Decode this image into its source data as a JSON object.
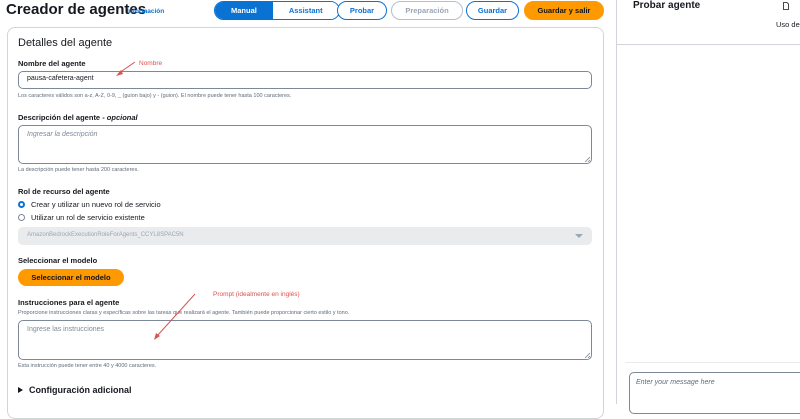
{
  "header": {
    "title": "Creador de agentes",
    "info": "Información",
    "tabs": [
      {
        "label": "Manual",
        "active": true
      },
      {
        "label": "Assistant",
        "active": false
      }
    ],
    "buttons": {
      "test": "Probar",
      "prepare": "Preparación",
      "save": "Guardar",
      "save_exit": "Guardar y salir"
    }
  },
  "details": {
    "title": "Detalles del agente",
    "name_label": "Nombre del agente",
    "name_value": "pausa-cafetera-agent",
    "name_hint": "Los caracteres válidos son a-z, A-Z, 0-9, _ (guion bajo) y - (guion). El nombre puede tener hasta 100 caracteres.",
    "desc_label": "Descripción del agente - ",
    "desc_optional": "opcional",
    "desc_placeholder": "Ingresar la descripción",
    "desc_hint": "La descripción puede tener hasta 200 caracteres.",
    "role_label": "Rol de recurso del agente",
    "role_option_new": "Crear y utilizar un nuevo rol de servicio",
    "role_option_existing": "Utilizar un rol de servicio existente",
    "role_selected": "new",
    "role_select_value": "AmazonBedrockExecutionRoleForAgents_CCYL8SPAC5N",
    "model_label": "Seleccionar el modelo",
    "model_button": "Seleccionar el modelo",
    "instr_label": "Instrucciones para el agente",
    "instr_desc": "Proporcione instrucciones claras y específicas sobre las tareas que realizará el agente. También puede proporcionar cierto estilo y tono.",
    "instr_placeholder": "Ingrese las instrucciones",
    "instr_hint": "Esta instrucción puede tener entre 40 y 4000 caracteres.",
    "advanced": "Configuración adicional"
  },
  "annotations": {
    "name_note": "Nombre",
    "prompt_note": "Prompt (idealmente en inglés)"
  },
  "test_panel": {
    "title": "Probar agente",
    "uso": "Uso de",
    "message_placeholder": "Enter your message here"
  },
  "colors": {
    "primary": "#0972d3",
    "accent": "#ff9900",
    "annotation": "#d9534f"
  }
}
